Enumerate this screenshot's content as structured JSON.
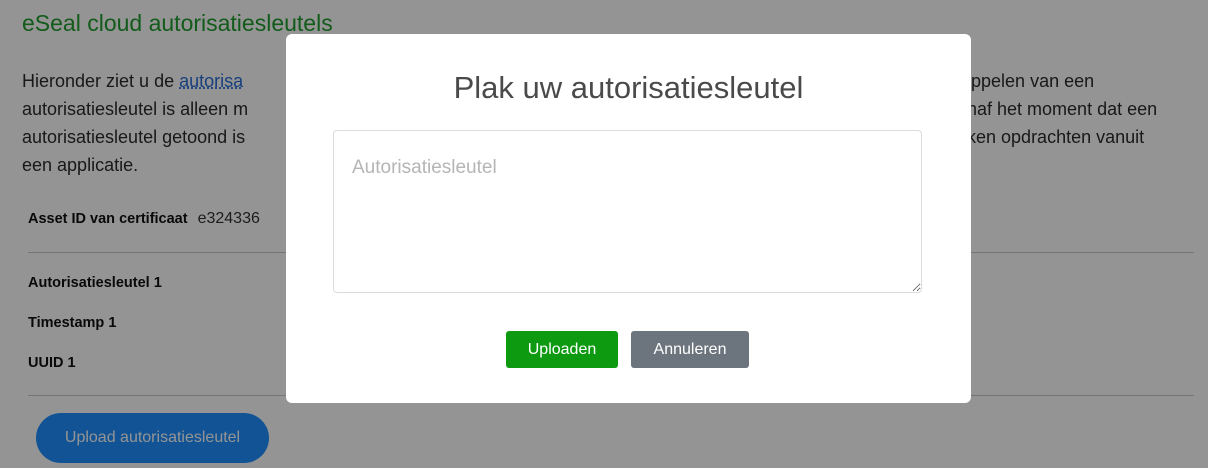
{
  "page": {
    "title": "eSeal cloud autorisatiesleutels",
    "intro": {
      "line1_prefix": "Hieronder ziet u de ",
      "line1_link": "autorisa",
      "line1_suffix": "",
      "line1_right": "oppelen van een",
      "line2_left": "autorisatiesleutel is alleen m",
      "line2_right": "naf het moment dat een",
      "line3_left": "autorisatiesleutel getoond is",
      "line3_right": "eken opdrachten vanuit",
      "line4": "een applicatie."
    },
    "asset_label": "Asset ID van certificaat",
    "asset_value": "e324336",
    "key_label": "Autorisatiesleutel 1",
    "timestamp_label": "Timestamp 1",
    "uuid_label": "UUID 1",
    "upload_button": "Upload autorisatiesleutel"
  },
  "modal": {
    "title": "Plak uw autorisatiesleutel",
    "textarea_placeholder": "Autorisatiesleutel",
    "textarea_value": "",
    "upload_label": "Uploaden",
    "cancel_label": "Annuleren"
  },
  "colors": {
    "title_green": "#1f9d2e",
    "link_blue": "#2a6fd8",
    "primary_green": "#0d9a11",
    "secondary_gray": "#6c757d",
    "upload_blue": "#1e90ff"
  }
}
